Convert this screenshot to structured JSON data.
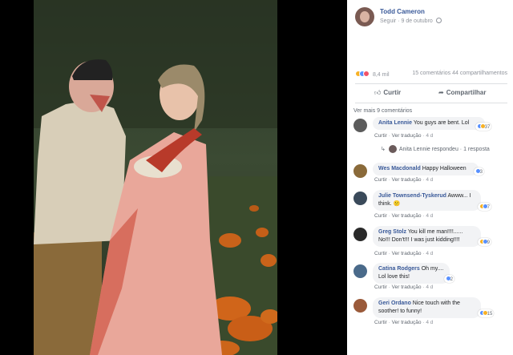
{
  "post": {
    "author": "Todd Cameron",
    "follow_label": "Seguir",
    "separator": "·",
    "date": "9 de outubro",
    "privacy_icon": "globe-icon"
  },
  "reactions": {
    "icons": [
      "haha-icon",
      "like-icon",
      "love-icon"
    ],
    "count": "8,4 mil",
    "comments": "15 comentários",
    "shares": "44 compartilhamentos"
  },
  "actions": {
    "like": "Curtir",
    "share": "Compartilhar"
  },
  "more_comments": "Ver mais 9 comentários",
  "comments": [
    {
      "name": "Anita Lennie",
      "text": "You guys are bent. Lol",
      "reaction_count": "37",
      "like": "Curtir",
      "translate": "Ver tradução",
      "time": "4 d",
      "avatar_color": "#5c5c5c"
    },
    {
      "name": "Wes Macdonald",
      "text": "Happy Halloween",
      "reaction_count": "3",
      "like": "Curtir",
      "translate": "Ver tradução",
      "time": "4 d",
      "avatar_color": "#8a6a3a"
    },
    {
      "name": "Julie Townsend-Tyskerud",
      "text": "Awww... I think. 😕",
      "reaction_count": "7",
      "like": "Curtir",
      "translate": "Ver tradução",
      "time": "4 d",
      "avatar_color": "#3a4a5a"
    },
    {
      "name": "Greg Stolz",
      "text": "You kill me man!!!!...... No!!! Don't!!! I was just kidding!!!!",
      "reaction_count": "9",
      "like": "Curtir",
      "translate": "Ver tradução",
      "time": "4 d",
      "avatar_color": "#2a2a2a"
    },
    {
      "name": "Catina Rodgers",
      "text": "Oh my.... Lol love this!",
      "reaction_count": "2",
      "like": "Curtir",
      "translate": "Ver tradução",
      "time": "4 d",
      "avatar_color": "#4a6a8a"
    },
    {
      "name": "Geri Ordano",
      "text": "Nice touch with the soother! to funny!",
      "reaction_count": "15",
      "like": "Curtir",
      "translate": "Ver tradução",
      "time": "4 d",
      "avatar_color": "#9a5a3a"
    }
  ],
  "reply": {
    "name": "Anita Lennie",
    "action": "respondeu",
    "separator": "·",
    "count": "1 resposta"
  }
}
